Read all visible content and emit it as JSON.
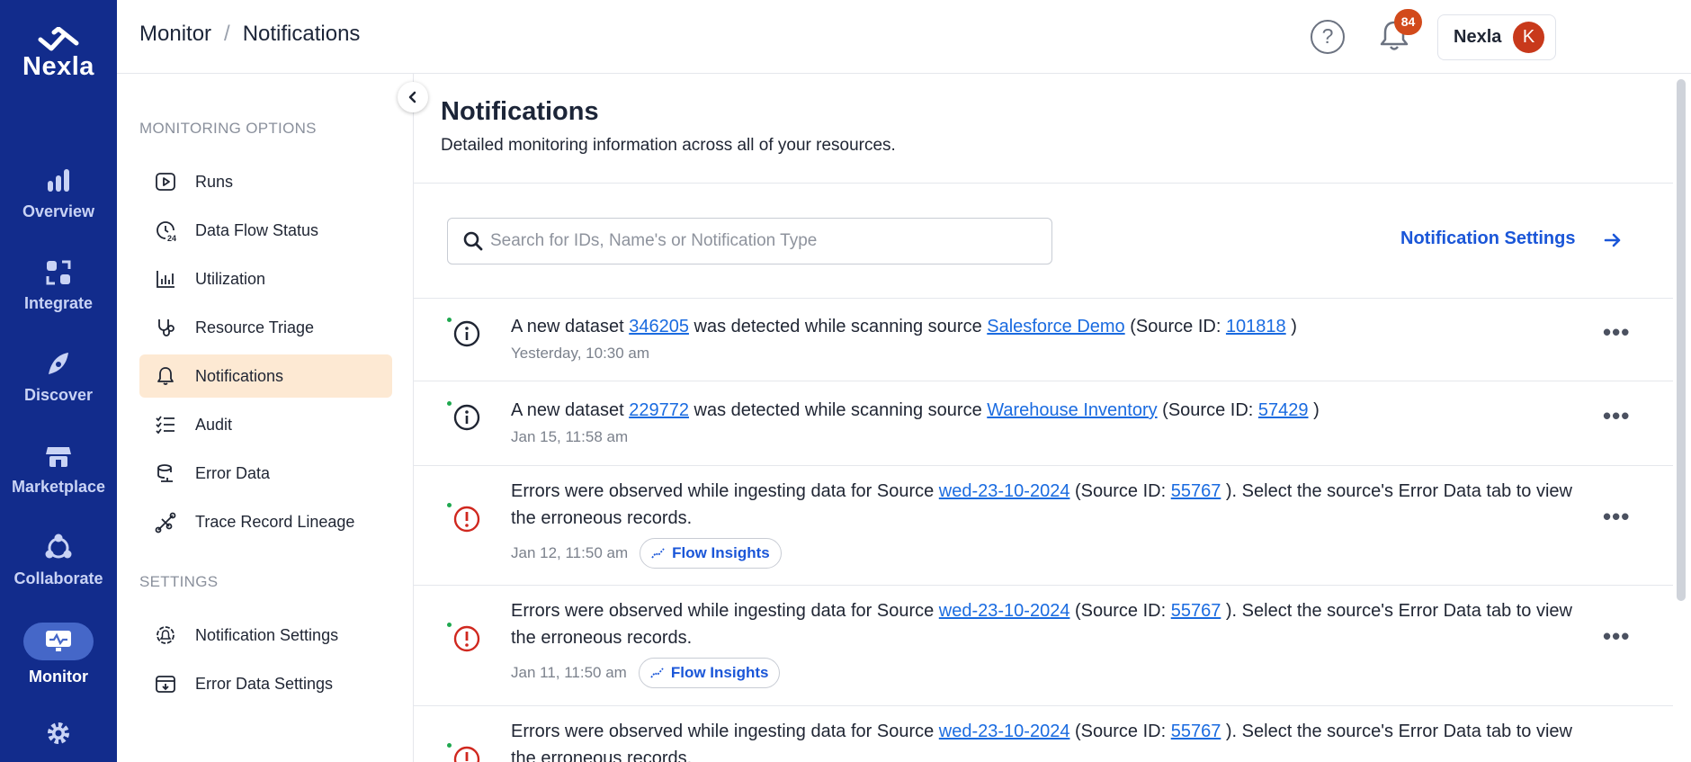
{
  "rail": {
    "logo": "Nexla",
    "items": [
      {
        "label": "Overview",
        "icon": "bar-chart-icon"
      },
      {
        "label": "Integrate",
        "icon": "integrate-icon"
      },
      {
        "label": "Discover",
        "icon": "compass-icon"
      },
      {
        "label": "Marketplace",
        "icon": "store-icon"
      },
      {
        "label": "Collaborate",
        "icon": "collaborate-icon"
      },
      {
        "label": "Monitor",
        "icon": "monitor-icon",
        "active": true
      },
      {
        "label": "Settings",
        "icon": "gear-icon"
      }
    ]
  },
  "topbar": {
    "crumb1": "Monitor",
    "crumb_sep": "/",
    "crumb2": "Notifications",
    "help": "?",
    "badge": "84",
    "user_name": "Nexla",
    "avatar": "K"
  },
  "submenu": {
    "section1": "MONITORING OPTIONS",
    "items1": [
      {
        "label": "Runs",
        "icon": "play-square-icon"
      },
      {
        "label": "Data Flow Status",
        "icon": "clock-24-icon"
      },
      {
        "label": "Utilization",
        "icon": "usage-chart-icon"
      },
      {
        "label": "Resource Triage",
        "icon": "stethoscope-icon"
      },
      {
        "label": "Notifications",
        "icon": "bell-icon",
        "active": true
      },
      {
        "label": "Audit",
        "icon": "checklist-icon"
      },
      {
        "label": "Error Data",
        "icon": "error-data-icon"
      },
      {
        "label": "Trace Record Lineage",
        "icon": "lineage-icon"
      }
    ],
    "section2": "SETTINGS",
    "items2": [
      {
        "label": "Notification Settings",
        "icon": "bell-gear-icon"
      },
      {
        "label": "Error Data Settings",
        "icon": "error-settings-icon"
      }
    ]
  },
  "main": {
    "title": "Notifications",
    "subtitle": "Detailed monitoring information across all of your resources.",
    "search_placeholder": "Search for IDs, Name's or Notification Type",
    "settings_link": "Notification Settings",
    "flow_insights": "Flow Insights",
    "notifications": [
      {
        "type": "info",
        "p1": "A new dataset ",
        "l1": "346205",
        "p2": " was detected while scanning source ",
        "l2": "Salesforce Demo",
        "p3": " (Source ID: ",
        "l3": "101818",
        "p4": " )",
        "time": "Yesterday, 10:30 am"
      },
      {
        "type": "info",
        "p1": "A new dataset ",
        "l1": "229772",
        "p2": " was detected while scanning source ",
        "l2": "Warehouse Inventory",
        "p3": " (Source ID: ",
        "l3": "57429",
        "p4": " )",
        "time": "Jan 15, 11:58 am"
      },
      {
        "type": "error",
        "p1": "Errors were observed while ingesting data for Source ",
        "l1": "wed-23-10-2024",
        "p2": " (Source ID: ",
        "l2": "55767",
        "p3": " ). Select the source's Error Data tab to view the erroneous records.",
        "time": "Jan 12, 11:50 am"
      },
      {
        "type": "error",
        "p1": "Errors were observed while ingesting data for Source ",
        "l1": "wed-23-10-2024",
        "p2": " (Source ID: ",
        "l2": "55767",
        "p3": " ). Select the source's Error Data tab to view the erroneous records.",
        "time": "Jan 11, 11:50 am"
      },
      {
        "type": "error",
        "p1": "Errors were observed while ingesting data for Source ",
        "l1": "wed-23-10-2024",
        "p2": " (Source ID: ",
        "l2": "55767",
        "p3": " ). Select the source's Error Data tab to view the erroneous records.",
        "time": ""
      }
    ]
  },
  "colors": {
    "rail": "#122c8c",
    "link": "#1a6be0",
    "accent": "#1a56d8",
    "active_item": "#fde9d3",
    "error": "#d0281f",
    "badge": "#d24a1b"
  }
}
